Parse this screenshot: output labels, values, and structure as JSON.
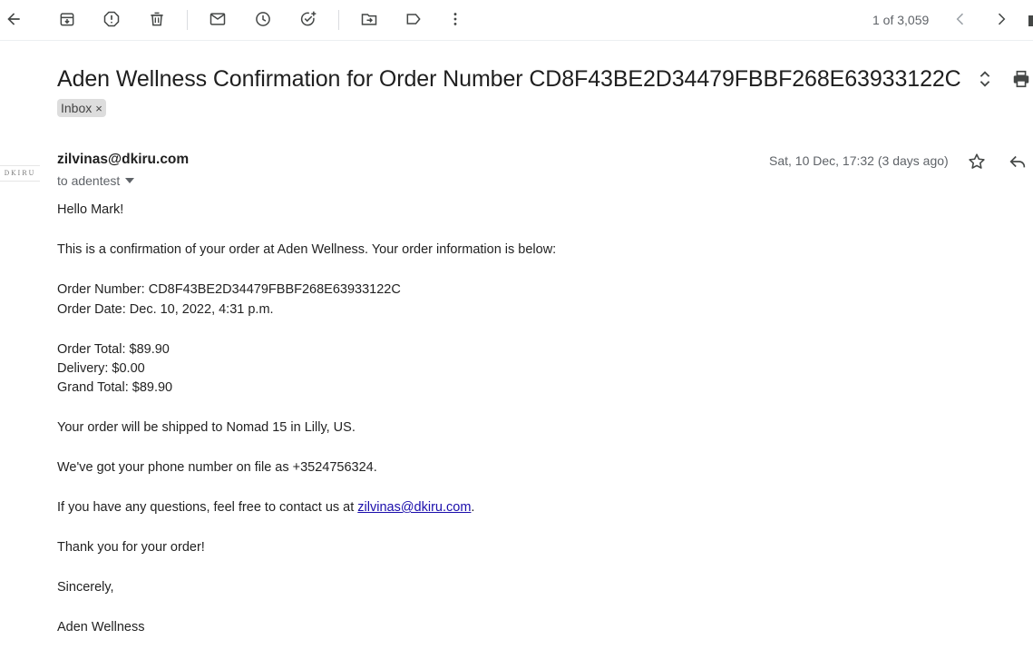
{
  "toolbar": {
    "icons": [
      "back-arrow-icon",
      "archive-icon",
      "report-spam-icon",
      "delete-icon",
      "mark-unread-icon",
      "snooze-icon",
      "add-task-icon",
      "move-to-icon",
      "label-icon",
      "more-vert-icon"
    ],
    "counter": "1 of 3,059"
  },
  "email": {
    "subject": "Aden Wellness Confirmation for Order Number CD8F43BE2D34479FBBF268E63933122C",
    "label": "Inbox",
    "label_remove": "×",
    "avatar_text": "DKIRU",
    "sender": "zilvinas@dkiru.com",
    "recipient": "to adentest",
    "date": "Sat, 10 Dec, 17:32 (3 days ago)",
    "body": {
      "greeting": "Hello Mark!",
      "intro": "This is a confirmation of your order at Aden Wellness. Your order information is below:",
      "order_number": "Order Number: CD8F43BE2D34479FBBF268E63933122C",
      "order_date": "Order Date: Dec. 10, 2022, 4:31 p.m.",
      "order_total": "Order Total: $89.90",
      "delivery": "Delivery: $0.00",
      "grand_total": "Grand Total: $89.90",
      "shipping": "Your order will be shipped to Nomad 15 in Lilly, US.",
      "phone": "We've got your phone number on file as +3524756324.",
      "questions_prefix": "If you have any questions, feel free to contact us at ",
      "contact_email": "zilvinas@dkiru.com",
      "questions_suffix": ".",
      "thanks": "Thank you for your order!",
      "signoff": "Sincerely,",
      "signature": "Aden Wellness"
    }
  },
  "colors": {
    "icon": "#444746",
    "link": "#1a0dab",
    "chip_bg": "#dddddd",
    "muted": "#5f6368"
  }
}
